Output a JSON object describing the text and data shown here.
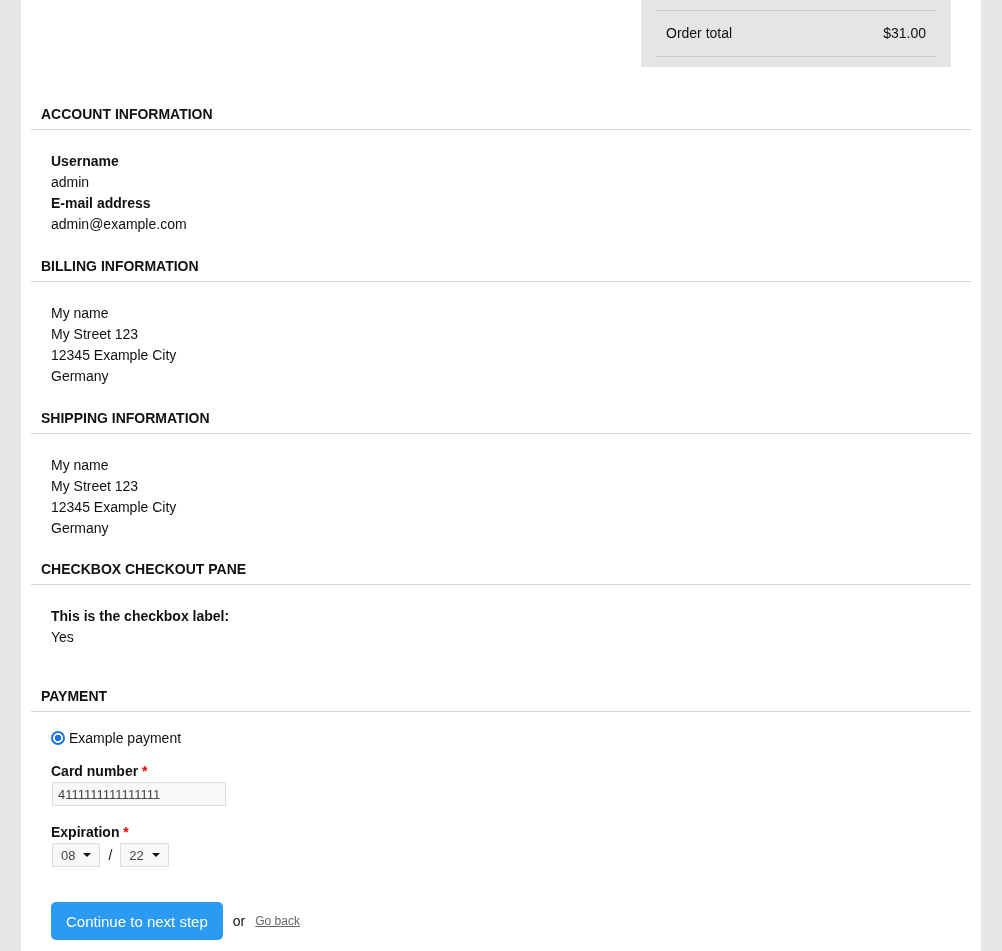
{
  "order_total": {
    "label": "Order total",
    "amount": "$31.00"
  },
  "sections": [
    {
      "kind": "fields",
      "title": "ACCOUNT INFORMATION",
      "fields": [
        {
          "label": "Username",
          "value": "admin"
        },
        {
          "label": "E-mail address",
          "value": "admin@example.com"
        }
      ]
    },
    {
      "kind": "lines",
      "title": "BILLING INFORMATION",
      "lines": [
        "My name",
        "My Street 123",
        "12345 Example City",
        "Germany"
      ]
    },
    {
      "kind": "lines",
      "title": "SHIPPING INFORMATION",
      "lines": [
        "My name",
        "My Street 123",
        "12345 Example City",
        "Germany"
      ]
    },
    {
      "kind": "fields",
      "title": "CHECKBOX CHECKOUT PANE",
      "fields": [
        {
          "label": "This is the checkbox label:",
          "value": "Yes"
        }
      ]
    }
  ],
  "payment": {
    "title": "PAYMENT",
    "methods": [
      {
        "label": "Example payment",
        "selected": true
      }
    ],
    "card_number": {
      "label": "Card number",
      "required_mark": "*",
      "value": "4111111111111111"
    },
    "expiration": {
      "label": "Expiration",
      "required_mark": "*",
      "month": "08",
      "separator": "/",
      "year": "22"
    }
  },
  "actions": {
    "submit": "Continue to next step",
    "or": "or",
    "back": "Go back"
  }
}
